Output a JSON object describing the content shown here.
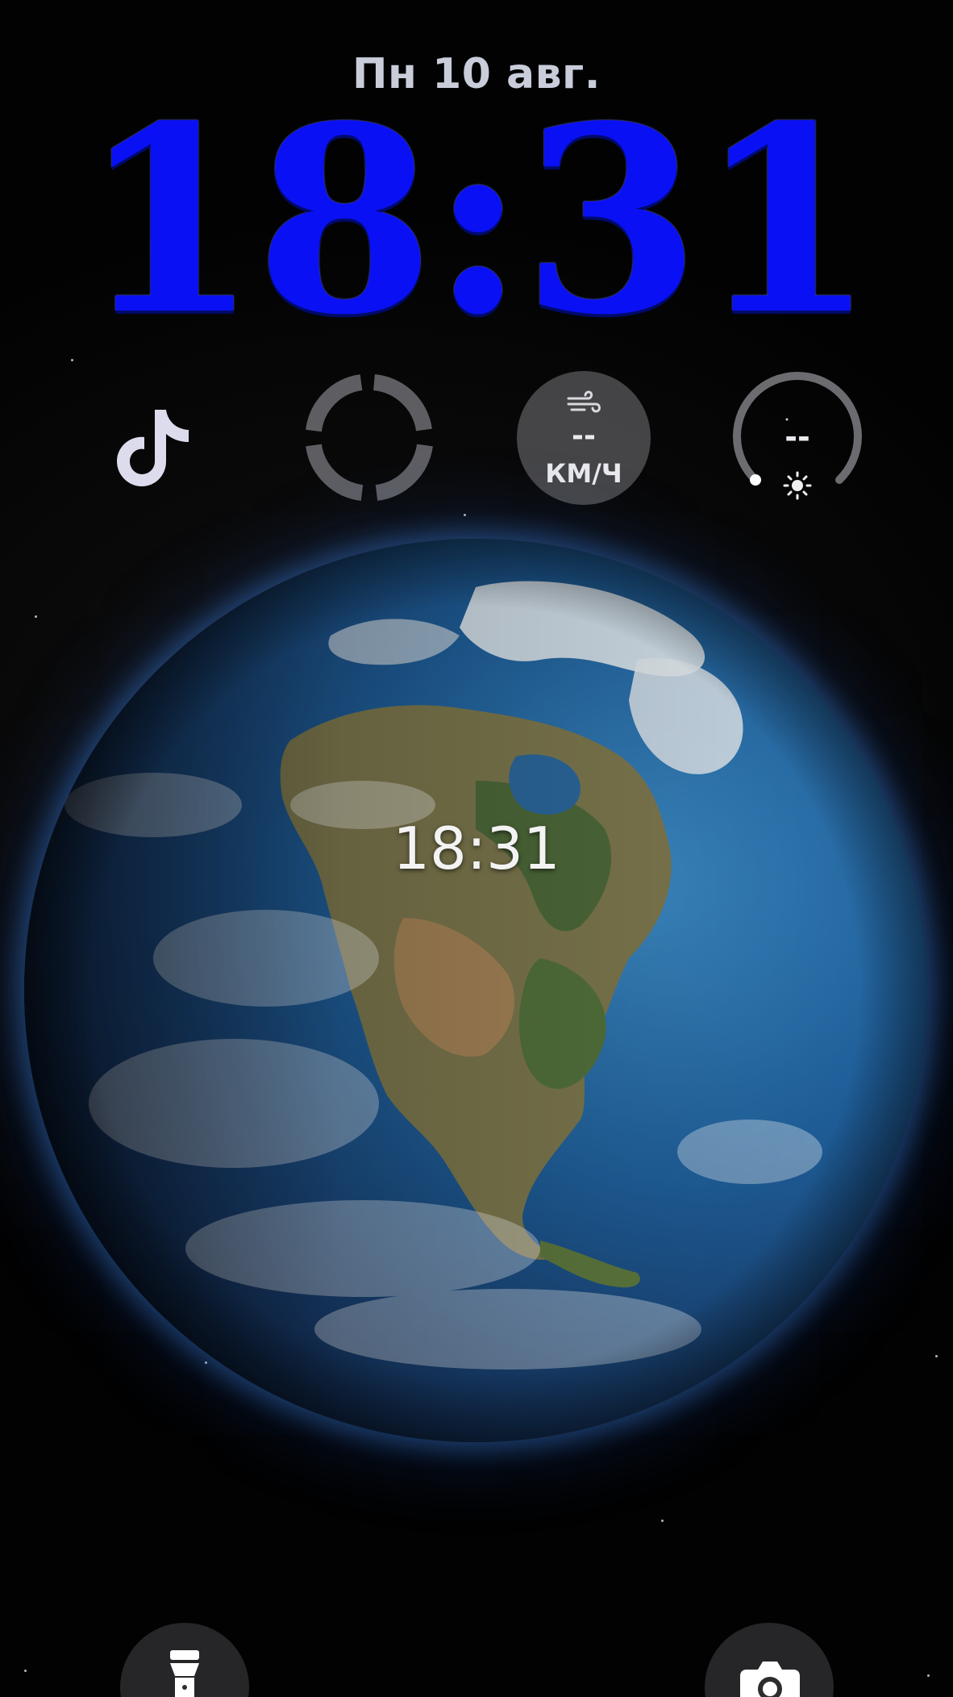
{
  "lockscreen": {
    "date": "Пн 10 авг.",
    "time": "18:31",
    "center_time": "18:31"
  },
  "widgets": {
    "tiktok": {
      "icon": "tiktok-icon"
    },
    "ring": {
      "icon": "activity-ring-icon"
    },
    "wind": {
      "icon": "wind-icon",
      "value": "--",
      "unit": "КМ/Ч"
    },
    "uv": {
      "icon": "sun-icon",
      "value": "--"
    }
  },
  "quick_actions": {
    "flashlight": {
      "icon": "flashlight-icon"
    },
    "camera": {
      "icon": "camera-icon"
    }
  },
  "colors": {
    "clock": "#0a10f4",
    "date": "#c9cdda",
    "widget_ring": "#5e5e62"
  }
}
